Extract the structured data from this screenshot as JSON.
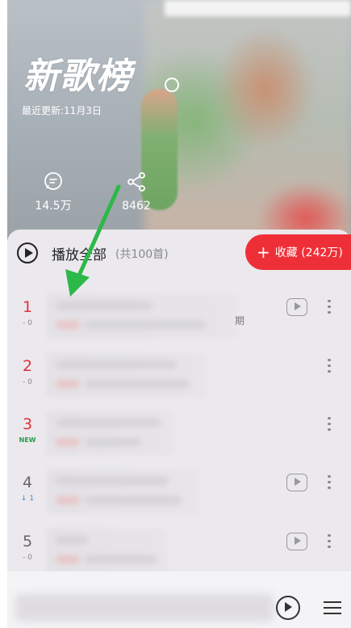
{
  "header": {
    "title": "新歌榜",
    "updated": "最近更新:11月3日",
    "comments_count": "14.5万",
    "share_count": "8462"
  },
  "toolbar": {
    "play_all_label": "播放全部",
    "play_all_count": "(共100首)",
    "collect_label": "收藏 (242万)",
    "collect_plus": "+"
  },
  "songs": [
    {
      "rank": "1",
      "trend": "- 0",
      "suffix": "期",
      "has_mv": true
    },
    {
      "rank": "2",
      "trend": "- 0",
      "suffix": "",
      "has_mv": false
    },
    {
      "rank": "3",
      "trend": "NEW",
      "suffix": "",
      "has_mv": false
    },
    {
      "rank": "4",
      "trend": "↓ 1",
      "suffix": "",
      "has_mv": true
    },
    {
      "rank": "5",
      "trend": "- 0",
      "suffix": "",
      "has_mv": true
    }
  ],
  "colors": {
    "accent": "#ef2f37",
    "new_badge": "#2a9a4a",
    "down_arrow": "#3a8ad4",
    "annotation_arrow": "#2db84a"
  },
  "icons": [
    "comment-icon",
    "share-icon",
    "play-all-icon",
    "mv-icon",
    "more-icon",
    "player-play-icon",
    "playlist-icon"
  ]
}
